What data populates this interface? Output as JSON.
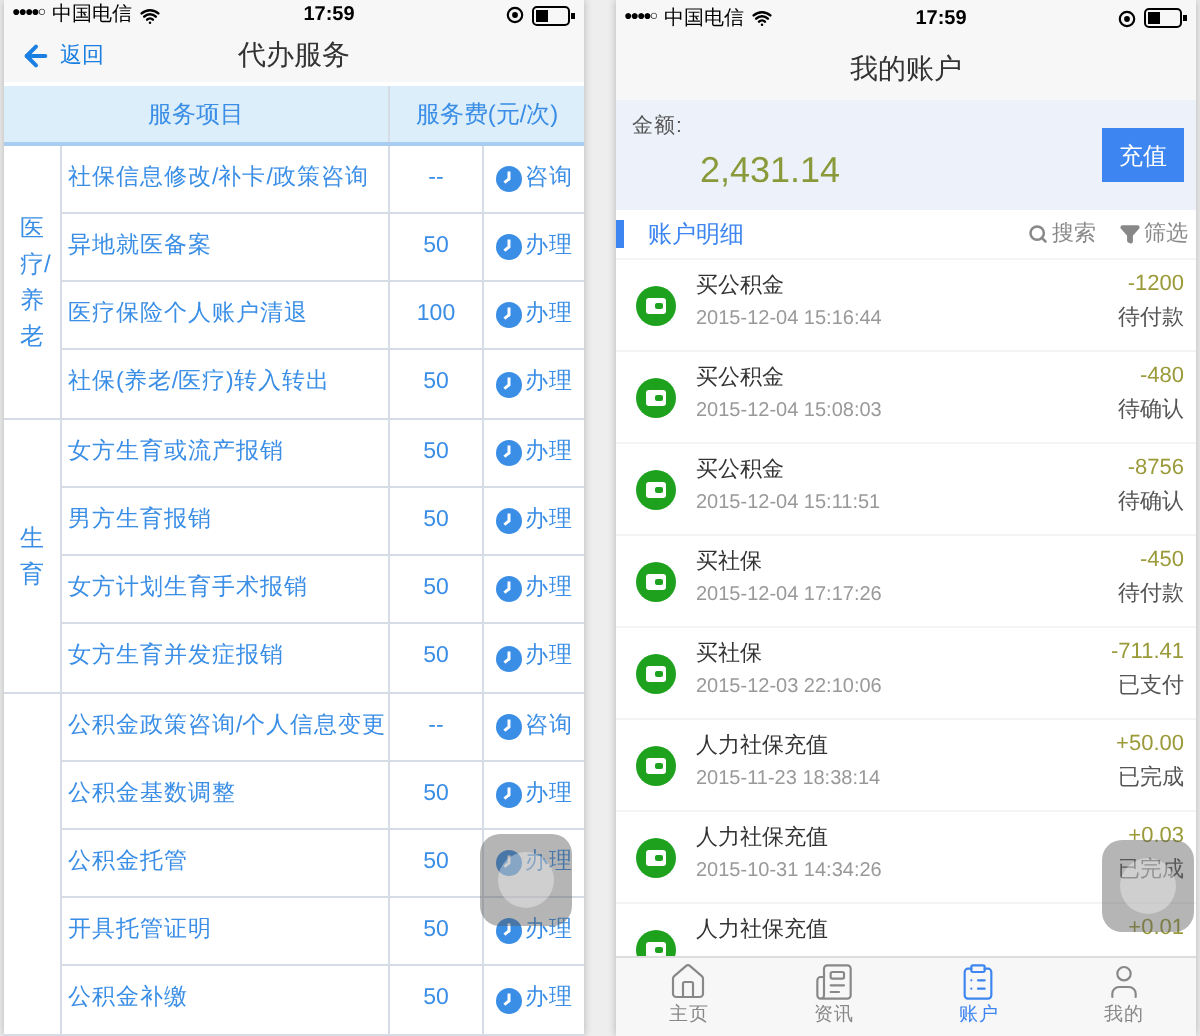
{
  "left": {
    "status_bar": {
      "signal": "●●●●○",
      "carrier": "中国电信",
      "time": "17:59"
    },
    "nav": {
      "back": "返回",
      "title": "代办服务"
    },
    "table": {
      "columns": [
        "服务项目",
        "服务费(元/次)"
      ],
      "groups": [
        {
          "label": "医疗/养老",
          "rows": [
            {
              "item": "社保信息修改/补卡/政策咨询",
              "fee": "--",
              "action": "咨询"
            },
            {
              "item": "异地就医备案",
              "fee": "50",
              "action": "办理"
            },
            {
              "item": "医疗保险个人账户清退",
              "fee": "100",
              "action": "办理"
            },
            {
              "item": "社保(养老/医疗)转入转出",
              "fee": "50",
              "action": "办理"
            }
          ]
        },
        {
          "label": "生育",
          "rows": [
            {
              "item": "女方生育或流产报销",
              "fee": "50",
              "action": "办理"
            },
            {
              "item": "男方生育报销",
              "fee": "50",
              "action": "办理"
            },
            {
              "item": "女方计划生育手术报销",
              "fee": "50",
              "action": "办理"
            },
            {
              "item": "女方生育并发症报销",
              "fee": "50",
              "action": "办理"
            }
          ]
        },
        {
          "rows": [
            {
              "item": "公积金政策咨询/个人信息变更",
              "fee": "--",
              "action": "咨询"
            },
            {
              "item": "公积金基数调整",
              "fee": "50",
              "action": "办理"
            },
            {
              "item": "公积金托管",
              "fee": "50",
              "action": "办理"
            },
            {
              "item": "开具托管证明",
              "fee": "50",
              "action": "办理"
            },
            {
              "item": "公积金补缴",
              "fee": "50",
              "action": "办理"
            }
          ]
        }
      ]
    }
  },
  "right": {
    "status_bar": {
      "signal": "●●●●○",
      "carrier": "中国电信",
      "time": "17:59"
    },
    "title": "我的账户",
    "balance": {
      "label": "金额:",
      "amount": "2,431.14",
      "button": "充值"
    },
    "section": {
      "title": "账户明细",
      "search": "搜索",
      "filter": "筛选"
    },
    "transactions": [
      {
        "title": "买公积金",
        "time": "2015-12-04 15:16:44",
        "amount": "-1200",
        "status": "待付款"
      },
      {
        "title": "买公积金",
        "time": "2015-12-04 15:08:03",
        "amount": "-480",
        "status": "待确认"
      },
      {
        "title": "买公积金",
        "time": "2015-12-04 15:11:51",
        "amount": "-8756",
        "status": "待确认"
      },
      {
        "title": "买社保",
        "time": "2015-12-04 17:17:26",
        "amount": "-450",
        "status": "待付款"
      },
      {
        "title": "买社保",
        "time": "2015-12-03 22:10:06",
        "amount": "-711.41",
        "status": "已支付"
      },
      {
        "title": "人力社保充值",
        "time": "2015-11-23 18:38:14",
        "amount": "+50.00",
        "status": "已完成"
      },
      {
        "title": "人力社保充值",
        "time": "2015-10-31 14:34:26",
        "amount": "+0.03",
        "status": "已完成"
      },
      {
        "title": "人力社保充值",
        "amount": "+0.01"
      }
    ],
    "tabs": [
      {
        "label": "主页",
        "kind": "home",
        "selected": false
      },
      {
        "label": "资讯",
        "kind": "news",
        "selected": false
      },
      {
        "label": "账户",
        "kind": "account",
        "selected": true
      },
      {
        "label": "我的",
        "kind": "profile",
        "selected": false
      }
    ]
  }
}
